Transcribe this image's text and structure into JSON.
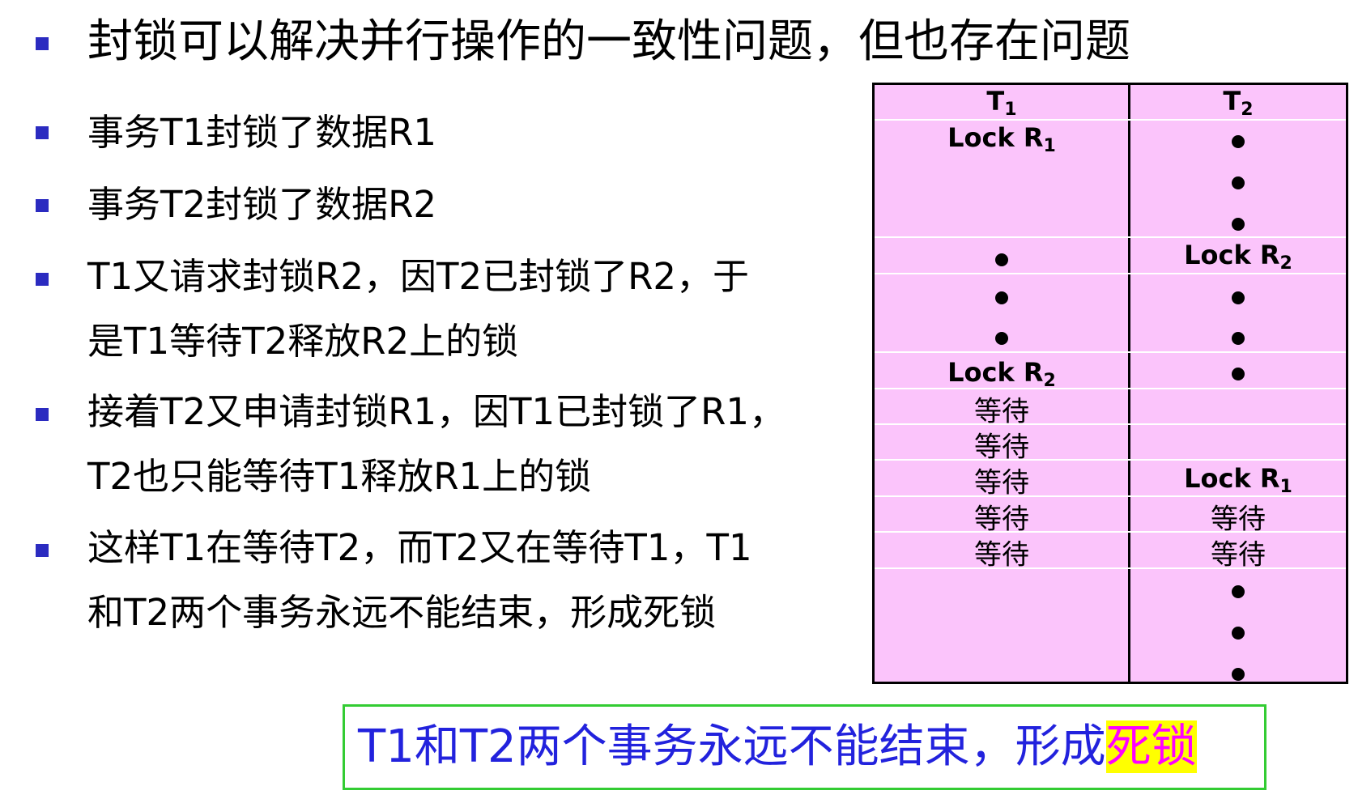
{
  "slide": {
    "title": "封锁可以解决并行操作的一致性问题，但也存在问题",
    "items": [
      {
        "lines": [
          "事务T1封锁了数据R1"
        ]
      },
      {
        "lines": [
          "事务T2封锁了数据R2"
        ]
      },
      {
        "lines": [
          "T1又请求封锁R2，因T2已封锁了R2，于",
          "是T1等待T2释放R2上的锁"
        ]
      },
      {
        "lines": [
          "接着T2又申请封锁R1，因T1已封锁了R1，",
          "T2也只能等待T1释放R1上的锁"
        ]
      },
      {
        "lines": [
          "这样T1在等待T2，而T2又在等待T1，T1",
          "和T2两个事务永远不能结束，形成死锁"
        ]
      }
    ],
    "conclusion": {
      "text": "T1和T2两个事务永远不能结束，形成",
      "highlight": "死锁"
    }
  },
  "lock_table": {
    "headers": {
      "t1_main": "T",
      "t1_sub": "1",
      "t2_main": "T",
      "t2_sub": "2"
    },
    "t1_lock_r1": {
      "main": "Lock R",
      "sub": "1"
    },
    "t2_lock_r2": {
      "main": "Lock R",
      "sub": "2"
    },
    "t1_lock_r2": {
      "main": "Lock R",
      "sub": "2"
    },
    "t2_lock_r1": {
      "main": "Lock R",
      "sub": "1"
    },
    "wait_label": "等待"
  },
  "colors": {
    "bullet": "#2b2bc0",
    "table_fill": "#fbc4fb",
    "conclusion_border": "#33cc33",
    "conclusion_text": "#2222dd",
    "highlight_bg": "#ffff00",
    "highlight_text": "#ff00ff"
  }
}
